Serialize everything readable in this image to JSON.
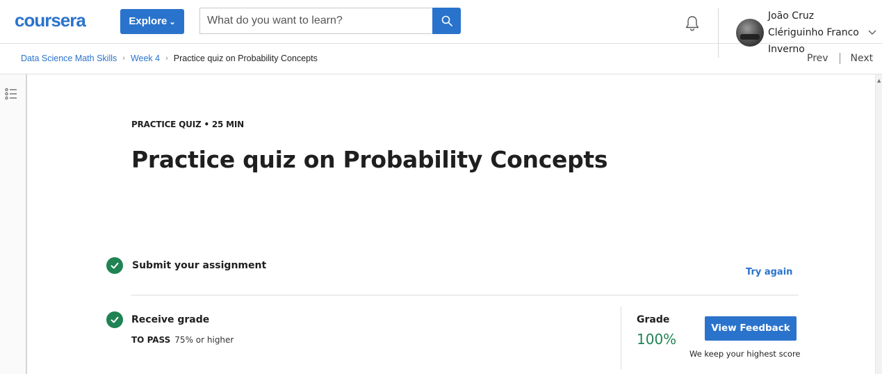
{
  "header": {
    "logo_text": "coursera",
    "explore_label": "Explore",
    "search": {
      "placeholder": "What do you want to learn?"
    },
    "user": {
      "name": "João Cruz Clériguinho Franco Inverno"
    },
    "notification_icon": "bell-icon",
    "search_icon": "search-icon"
  },
  "breadcrumb": {
    "items": [
      "Data Science Math Skills",
      "Week 4",
      "Practice quiz on Probability Concepts"
    ]
  },
  "nav": {
    "prev_label": "Prev",
    "next_label": "Next"
  },
  "quiz": {
    "kicker": "PRACTICE QUIZ • 25 MIN",
    "title": "Practice quiz on Probability Concepts",
    "step_submit": "Submit your assignment",
    "try_again": "Try again",
    "step_grade": "Receive grade",
    "to_pass_label": "TO PASS",
    "to_pass_value": "75% or higher",
    "grade_label": "Grade",
    "grade_value": "100%",
    "view_feedback": "View Feedback",
    "highest_note": "We keep your highest score"
  },
  "colors": {
    "brand_blue": "#2a73cc",
    "success_green": "#1f8354",
    "text": "#1f1f1f"
  }
}
